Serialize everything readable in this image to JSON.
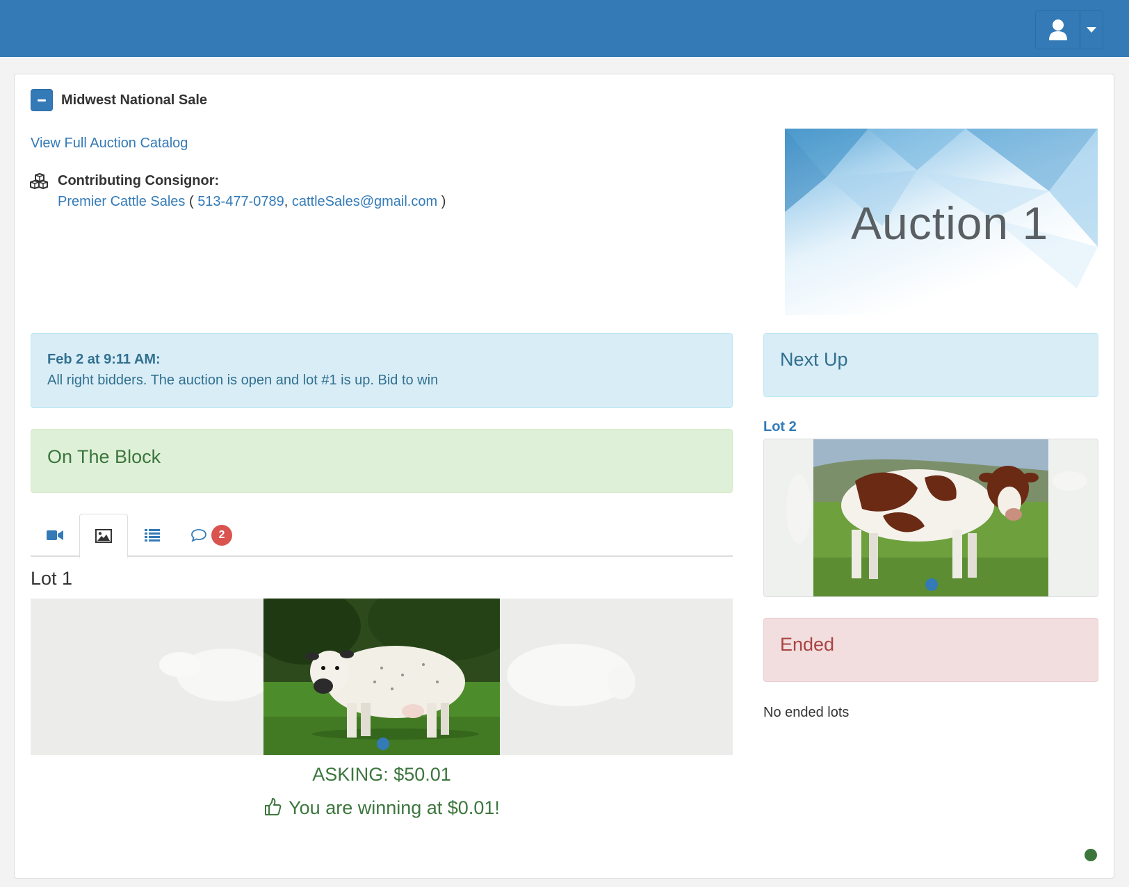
{
  "header": {
    "user_menu": {
      "icon": "user-icon",
      "caret": "caret-down-icon"
    }
  },
  "sale": {
    "title": "Midwest National Sale",
    "catalog_link": "View Full Auction Catalog",
    "consignor_label": "Contributing Consignor:",
    "consignor_name": "Premier Cattle Sales",
    "consignor_open": " ( ",
    "consignor_phone": "513-477-0789",
    "consignor_sep": ", ",
    "consignor_email": "cattleSales@gmail.com",
    "consignor_close": " )",
    "banner_text": "Auction 1"
  },
  "announcement": {
    "timestamp": "Feb 2 at 9:11 AM:",
    "message": "All right bidders. The auction is open and lot #1 is up. Bid to win"
  },
  "on_the_block": {
    "heading": "On The Block",
    "tabs": [
      {
        "icon": "video-camera-icon"
      },
      {
        "icon": "image-icon",
        "active": true
      },
      {
        "icon": "list-icon"
      },
      {
        "icon": "comment-icon",
        "badge": "2"
      }
    ],
    "lot_title": "Lot 1",
    "asking": "ASKING: $50.01",
    "winning": "You are winning at $0.01!"
  },
  "next_up": {
    "heading": "Next Up",
    "lot_link": "Lot 2"
  },
  "ended": {
    "heading": "Ended",
    "empty_text": "No ended lots"
  },
  "colors": {
    "primary": "#337ab7",
    "info_bg": "#d9edf7",
    "success_bg": "#dff0d8",
    "danger_bg": "#f2dede",
    "success_text": "#3c763d",
    "badge": "#d9534f"
  }
}
